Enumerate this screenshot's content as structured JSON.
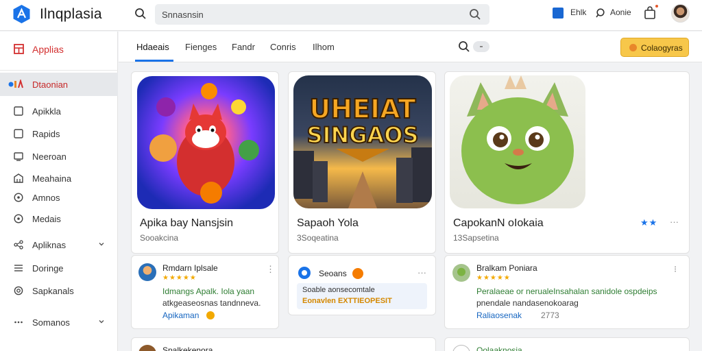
{
  "header": {
    "app_name": "Ilnqplasia",
    "search_value": "Snnasnsin",
    "item_1": "Ehlk",
    "item_2": "Aonie"
  },
  "sidebar": {
    "section_title": "Applias",
    "active_item": "Dtaonian",
    "items": [
      {
        "label": "Apikkla",
        "icon": "square-icon",
        "chevron": false
      },
      {
        "label": "Rapids",
        "icon": "square-icon",
        "chevron": false
      },
      {
        "label": "Neeroan",
        "icon": "screen-icon",
        "chevron": false
      },
      {
        "label": "Meahaina",
        "icon": "building-icon",
        "chevron": false
      },
      {
        "label": "Amnos",
        "icon": "info-icon",
        "chevron": false
      },
      {
        "label": "Medais",
        "icon": "info-icon",
        "chevron": false
      },
      {
        "label": "Apliknas",
        "icon": "share-icon",
        "chevron": true
      },
      {
        "label": "Doringe",
        "icon": "menu-icon",
        "chevron": false
      },
      {
        "label": "Sapkanals",
        "icon": "settings-icon",
        "chevron": false
      },
      {
        "label": "Somanos",
        "icon": "more-icon",
        "chevron": true
      }
    ]
  },
  "tabs": [
    "Hdaeais",
    "Fienges",
    "Fandr",
    "Conris",
    "Ilhom"
  ],
  "active_tab": 0,
  "cta_label": "Colaogyras",
  "cards": [
    {
      "thumb_text": "",
      "title": "Apika bay Nansjsin",
      "subtitle": "Sooakcina",
      "review": {
        "name": "Rmdarn Iplsale",
        "stars": "★★★★★",
        "text1": "Idmangs Apalk. Iola yaan",
        "text2": "atkgeaseosnas tandnneva.",
        "link": "Apikaman"
      }
    },
    {
      "thumb_text_1": "UHEIAT",
      "thumb_text_2": "SINGAOS",
      "title": "Sapaoh Yola",
      "subtitle": "3Soqeatina",
      "tag_1": "Seoans",
      "box_line_1": "Soable aonsecomtale",
      "box_line_2": "Eonavlen EXTTIEOPESIT"
    },
    {
      "title": "CapokanN oIokaia",
      "subtitle": "13Sapsetina",
      "review": {
        "name": "Bralkam Poniara",
        "stars": "★★★★★",
        "text1": "Peralaeae or  nerualeInsahalan sanidole ospdeips",
        "text2": "pnendale  nandasenokoarag",
        "link": "Raliaosenak",
        "count": "2773"
      }
    }
  ],
  "bottom_cards": [
    {
      "name": "Spalkekenora"
    },
    {
      "name": "Oolaaknosia"
    }
  ],
  "colors": {
    "accent": "#1a73e8",
    "brand_red": "#d32f2f",
    "cta": "#f7c74a",
    "star": "#f2a900"
  }
}
